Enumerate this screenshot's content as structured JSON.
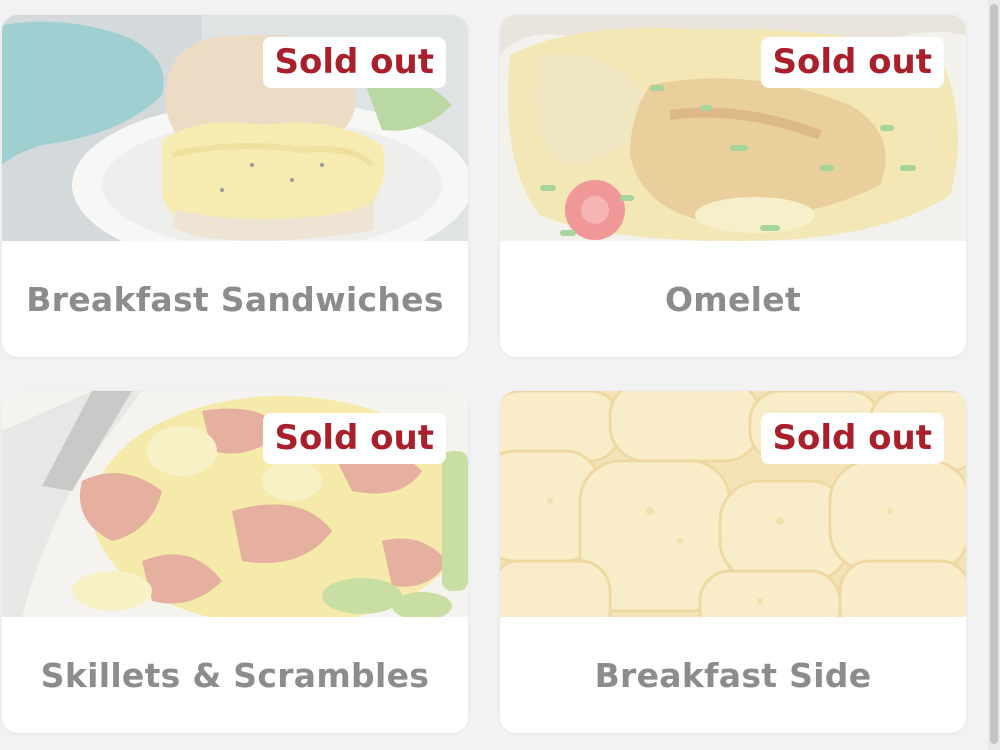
{
  "menu": {
    "badge_text": "Sold out",
    "items": [
      {
        "title": "Breakfast Sandwiches",
        "badge": "Sold out",
        "image": "breakfast-sandwich-photo"
      },
      {
        "title": "Omelet",
        "badge": "Sold out",
        "image": "omelet-photo"
      },
      {
        "title": "Skillets & Scrambles",
        "badge": "Sold out",
        "image": "skillet-scramble-photo"
      },
      {
        "title": "Breakfast Side",
        "badge": "Sold out",
        "image": "tater-tots-photo"
      }
    ]
  },
  "colors": {
    "badge_text": "#a91f2c",
    "title_text": "#8c8c8c",
    "card_bg": "#ffffff",
    "page_bg": "#f2f2f3"
  }
}
